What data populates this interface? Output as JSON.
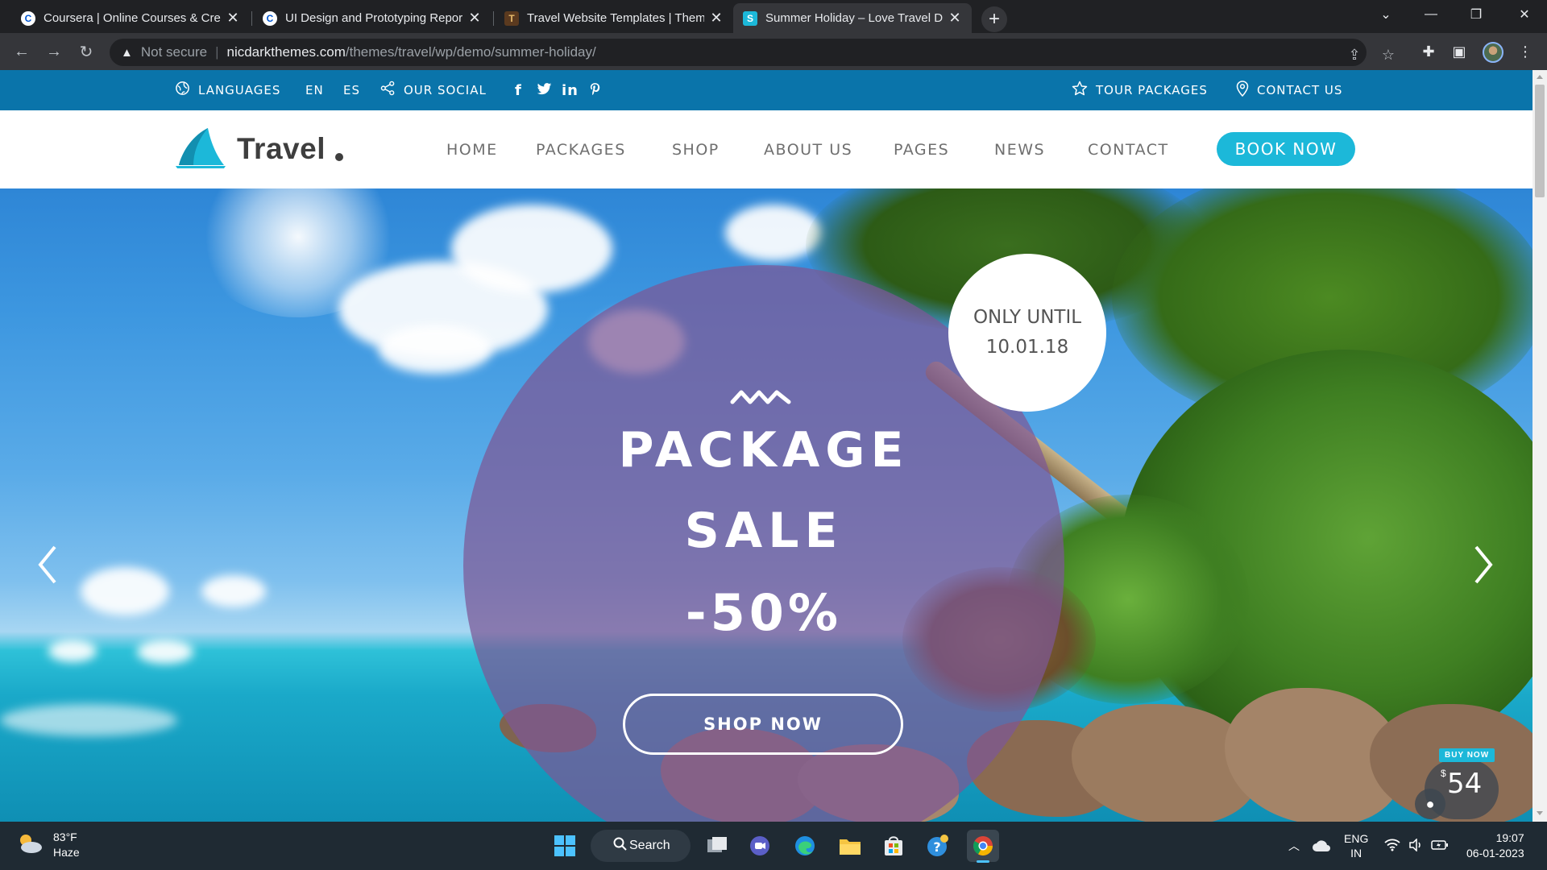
{
  "browser": {
    "tabs": [
      {
        "title": "Coursera | Online Courses & Credentials",
        "favicon": "C",
        "favicon_color": "#0056d2",
        "active": false
      },
      {
        "title": "UI Design and Prototyping Report",
        "favicon": "C",
        "favicon_color": "#0056d2",
        "active": false
      },
      {
        "title": "Travel Website Templates | ThemeForest",
        "favicon": "T",
        "favicon_color": "#5b3a1f",
        "active": false
      },
      {
        "title": "Summer Holiday – Love Travel Demo",
        "favicon": "S",
        "favicon_color": "#1cb8d9",
        "active": true
      }
    ],
    "new_tab_label": "+",
    "address": {
      "security_label": "Not secure",
      "host": "nicdarkthemes.com",
      "path": "/themes/travel/wp/demo/summer-holiday/"
    }
  },
  "site": {
    "topbar": {
      "languages_label": "LANGUAGES",
      "lang_en": "EN",
      "lang_es": "ES",
      "social_label": "OUR SOCIAL",
      "social_icons": [
        "facebook-icon",
        "twitter-icon",
        "linkedin-icon",
        "pinterest-icon"
      ],
      "tour_packages_label": "TOUR PACKAGES",
      "contact_label": "CONTACT US",
      "bg_color": "#0a74aa"
    },
    "logo": {
      "text": "Travel"
    },
    "nav": {
      "items": [
        "HOME",
        "PACKAGES",
        "SHOP",
        "ABOUT US",
        "PAGES",
        "NEWS",
        "CONTACT"
      ],
      "book_now": "BOOK NOW",
      "accent_color": "#1cb8d9"
    },
    "hero": {
      "badge_line1": "ONLY UNTIL",
      "badge_line2": "10.01.18",
      "title_line1": "PACKAGE",
      "title_line2": "SALE",
      "discount": "-50%",
      "cta": "SHOP NOW",
      "buy_now_label": "BUY NOW",
      "buy_now_currency": "$",
      "buy_now_price": "54"
    }
  },
  "taskbar": {
    "weather_temp": "83°F",
    "weather_desc": "Haze",
    "search_label": "Search",
    "lang_top": "ENG",
    "lang_bottom": "IN",
    "time": "19:07",
    "date": "06-01-2023"
  }
}
